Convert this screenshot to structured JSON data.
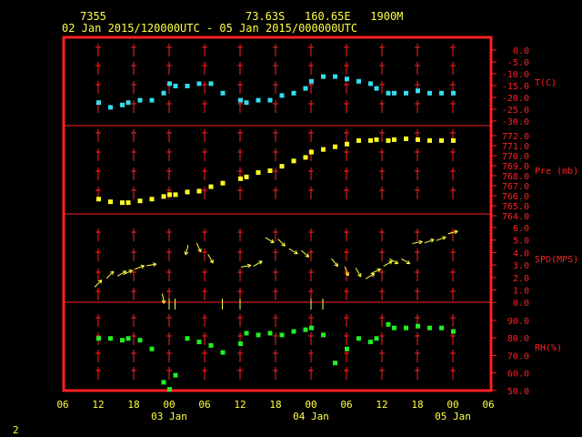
{
  "header": {
    "station_id": "7355",
    "location": "73.63S   160.65E   1900M",
    "time_range": "02 Jan 2015/120000UTC - 05 Jan 2015/000000UTC"
  },
  "footer_number": "2",
  "colors": {
    "frame": "#ff2020",
    "temp": "#33ddee",
    "pressure": "#ffff22",
    "wind": "#ffff44",
    "rh": "#22ee22",
    "text": "#ffff44"
  },
  "x_axis": {
    "ticks": [
      "06",
      "12",
      "18",
      "00",
      "06",
      "12",
      "18",
      "00",
      "06",
      "12",
      "18",
      "00",
      "06"
    ],
    "date_labels": [
      "03 Jan",
      "04 Jan",
      "05 Jan"
    ],
    "hours": [
      -6,
      0,
      6,
      12,
      18,
      24,
      30,
      36,
      42,
      48,
      54,
      60,
      66
    ]
  },
  "panels": {
    "temp": {
      "label": "T(C)",
      "ticks": [
        "0.0",
        "-5.0",
        "-10.0",
        "-15.0",
        "-20.0",
        "-25.0",
        "-30.0"
      ]
    },
    "pressure": {
      "label": "Pre (mb)",
      "ticks": [
        "772.0",
        "771.0",
        "770.0",
        "769.0",
        "768.0",
        "767.0",
        "766.0",
        "765.0",
        "764.0"
      ]
    },
    "wind": {
      "label": "SPD(MPS)",
      "ticks": [
        "6.0",
        "5.0",
        "4.0",
        "3.0",
        "2.0",
        "1.0",
        "0.0"
      ]
    },
    "rh": {
      "label": "RH(%)",
      "ticks": [
        "90.0",
        "80.0",
        "70.0",
        "60.0",
        "50.0"
      ]
    }
  },
  "chart_data": [
    {
      "type": "scatter",
      "name": "T(C)",
      "xlabel": "hours since 02 Jan 2015 12UTC",
      "ylim": [
        -30,
        0
      ],
      "x": [
        0,
        2,
        4,
        5,
        7,
        9,
        11,
        12,
        13,
        15,
        17,
        19,
        21,
        24,
        25,
        27,
        29,
        31,
        33,
        35,
        36,
        38,
        40,
        42,
        44,
        46,
        47,
        49,
        50,
        52,
        54,
        56,
        58,
        60
      ],
      "y": [
        -22,
        -24,
        -23,
        -22,
        -21,
        -21,
        -18,
        -14,
        -15,
        -15,
        -14,
        -14,
        -18,
        -21,
        -22,
        -21,
        -21,
        -19,
        -18,
        -16,
        -13,
        -11,
        -11,
        -12,
        -13,
        -14,
        -16,
        -18,
        -18,
        -18,
        -17,
        -18,
        -18,
        -18
      ]
    },
    {
      "type": "scatter",
      "name": "Pre (mb)",
      "ylim": [
        764,
        772
      ],
      "x": [
        0,
        2,
        4,
        5,
        7,
        9,
        11,
        12,
        13,
        15,
        17,
        19,
        21,
        24,
        25,
        27,
        29,
        31,
        33,
        35,
        36,
        38,
        40,
        42,
        44,
        46,
        47,
        49,
        50,
        52,
        54,
        56,
        58,
        60
      ],
      "y": [
        764.9,
        764.6,
        764.5,
        764.5,
        764.7,
        764.9,
        765.2,
        765.4,
        765.4,
        765.7,
        765.8,
        766.3,
        766.7,
        767.2,
        767.4,
        767.9,
        768.1,
        768.6,
        769.2,
        769.6,
        770.2,
        770.5,
        770.8,
        771.1,
        771.5,
        771.5,
        771.6,
        771.5,
        771.6,
        771.7,
        771.6,
        771.5,
        771.5,
        771.5
      ]
    },
    {
      "type": "vector",
      "name": "SPD(MPS)",
      "ylim": [
        0,
        6
      ],
      "x": [
        0,
        2,
        4,
        5,
        7,
        9,
        11,
        12,
        13,
        15,
        17,
        19,
        21,
        24,
        25,
        27,
        29,
        31,
        33,
        35,
        36,
        38,
        40,
        42,
        44,
        46,
        47,
        49,
        50,
        52,
        54,
        56,
        58,
        60
      ],
      "speed": [
        1.5,
        2.2,
        2.3,
        2.4,
        2.8,
        3.0,
        0.3,
        0.0,
        0.0,
        4.2,
        4.4,
        3.5,
        0.0,
        0.0,
        2.9,
        3.1,
        5.0,
        4.8,
        4.1,
        3.9,
        0.0,
        0.0,
        3.2,
        2.5,
        2.4,
        2.1,
        2.5,
        3.1,
        3.3,
        3.3,
        4.8,
        4.9,
        5.1,
        5.6
      ],
      "dir_from_deg": [
        225,
        225,
        240,
        245,
        250,
        260,
        350,
        0,
        0,
        15,
        335,
        330,
        0,
        0,
        260,
        240,
        300,
        315,
        300,
        310,
        0,
        160,
        320,
        340,
        330,
        240,
        245,
        240,
        300,
        300,
        260,
        250,
        250,
        255
      ]
    },
    {
      "type": "scatter",
      "name": "RH(%)",
      "ylim": [
        50,
        90
      ],
      "x": [
        0,
        2,
        4,
        5,
        7,
        9,
        11,
        12,
        13,
        15,
        17,
        19,
        21,
        24,
        25,
        27,
        29,
        31,
        33,
        35,
        36,
        38,
        40,
        42,
        44,
        46,
        47,
        49,
        50,
        52,
        54,
        56,
        58,
        60
      ],
      "y": [
        80,
        80,
        79,
        80,
        79,
        74,
        55,
        51,
        59,
        80,
        78,
        76,
        72,
        77,
        83,
        82,
        83,
        82,
        84,
        85,
        86,
        82,
        66,
        74,
        80,
        78,
        80,
        88,
        86,
        86,
        87,
        86,
        86,
        84
      ]
    }
  ]
}
